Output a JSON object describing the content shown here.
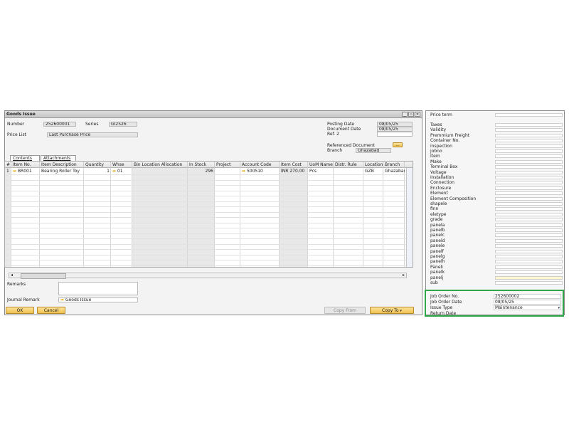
{
  "window": {
    "title": "Goods Issue"
  },
  "header": {
    "number_label": "Number",
    "number_value": "252600001",
    "series_label": "Series",
    "series_value": "GI2526",
    "price_list_label": "Price List",
    "price_list_value": "Last Purchase Price",
    "posting_date_label": "Posting Date",
    "posting_date_value": "08/05/25",
    "document_date_label": "Document Date",
    "document_date_value": "08/05/25",
    "ref2_label": "Ref. 2",
    "ref_doc_label": "Referenced Document",
    "ref_doc_button": "...",
    "branch_label": "Branch",
    "branch_value": "Ghazabad"
  },
  "tabs": [
    "Contents",
    "Attachments"
  ],
  "grid": {
    "columns": [
      "#",
      "Item No.",
      "Item Description",
      "Quantity",
      "Whse",
      "Bin Location Allocation",
      "In Stock",
      "Project",
      "Account Code",
      "Item Cost",
      "UoM Name",
      "Distr. Rule",
      "Location",
      "Branch"
    ],
    "rows": [
      {
        "num": "1",
        "item_no": "BR001",
        "desc": "Bearing Roller Toy",
        "qty": "1",
        "whse": "01",
        "in_stock": "296",
        "account": "500510",
        "cost": "INR 270.00",
        "uom": "Pcs",
        "location": "GZB",
        "branch": "Ghazabad"
      }
    ]
  },
  "footer": {
    "remarks_label": "Remarks",
    "journal_label": "Journal Remark",
    "journal_value": "Goods Issue",
    "ok": "OK",
    "cancel": "Cancel",
    "copy_from": "Copy From",
    "copy_to": "Copy To"
  },
  "udf": {
    "title": "Price term",
    "fields": [
      "Taxes",
      "Validity",
      "Premmium Freight",
      "Container No.",
      "inspection",
      "jobno",
      "Item",
      "Make",
      "Terminal Box",
      "Voltage",
      "Installation",
      "Connection",
      "Enclosure",
      "Element",
      "Element Composition",
      "shapele",
      "finn",
      "eletype",
      "grade",
      "panela",
      "panelb",
      "panelc",
      "paneld",
      "panele",
      "panelf",
      "panelg",
      "panelh",
      "Paneli",
      "panelk",
      "panelj",
      "sub"
    ],
    "job": {
      "order_no_label": "Job Order No.",
      "order_no_value": "252600002",
      "order_date_label": "Job Order Date",
      "order_date_value": "08/05/25",
      "issue_type_label": "Issue Type",
      "issue_type_value": "Maintenance",
      "return_date_label": "Return Date"
    }
  }
}
